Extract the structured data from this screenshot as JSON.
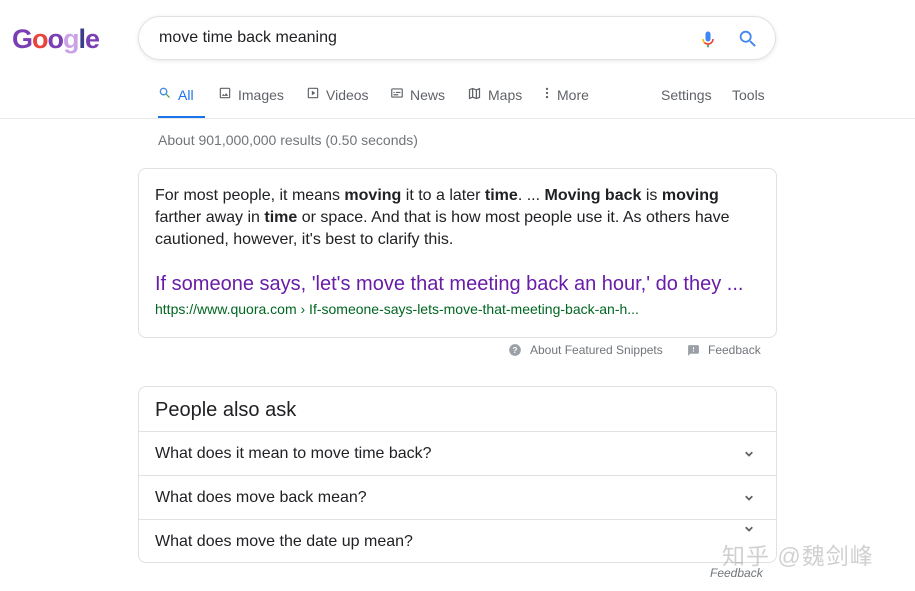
{
  "logo": {
    "text": "Google",
    "colors": [
      "#7b3fb4",
      "#e8433c",
      "#7b3fb4",
      "#c9a3e6",
      "#3c3c8c",
      "#7b3fb4"
    ]
  },
  "search": {
    "query": "move time back meaning"
  },
  "tabs": [
    {
      "label": "All",
      "icon": "search-icon",
      "active": true
    },
    {
      "label": "Images",
      "icon": "image-icon"
    },
    {
      "label": "Videos",
      "icon": "video-icon"
    },
    {
      "label": "News",
      "icon": "news-icon"
    },
    {
      "label": "Maps",
      "icon": "map-icon"
    },
    {
      "label": "More",
      "icon": "more-vert-icon"
    }
  ],
  "tools": {
    "settings": "Settings",
    "tools": "Tools"
  },
  "result_stats": "About 901,000,000 results (0.50 seconds)",
  "featured_snippet": {
    "segments": [
      {
        "text": "For most people, it means ",
        "bold": false
      },
      {
        "text": "moving",
        "bold": true
      },
      {
        "text": " it to a later ",
        "bold": false
      },
      {
        "text": "time",
        "bold": true
      },
      {
        "text": ". ... ",
        "bold": false
      },
      {
        "text": "Moving back",
        "bold": true
      },
      {
        "text": " is ",
        "bold": false
      },
      {
        "text": "moving",
        "bold": true
      },
      {
        "text": " farther away in ",
        "bold": false
      },
      {
        "text": "time",
        "bold": true
      },
      {
        "text": " or space. And that is how most people use it. As others have cautioned, however, it's best to clarify this.",
        "bold": false
      }
    ],
    "link_title": "If someone says, 'let's move that meeting back an hour,' do they ...",
    "url": "https://www.quora.com › If-someone-says-lets-move-that-meeting-back-an-h..."
  },
  "snippet_footer": {
    "about": "About Featured Snippets",
    "feedback": "Feedback"
  },
  "people_also_ask": {
    "title": "People also ask",
    "questions": [
      "What does it mean to move time back?",
      "What does move back mean?",
      "What does move the date up mean?"
    ]
  },
  "bottom_feedback": "Feedback",
  "watermark": "知乎 @魏剑峰",
  "colors": {
    "accent": "#1a73e8",
    "visited_link": "#681da8",
    "url_green": "#006621"
  }
}
